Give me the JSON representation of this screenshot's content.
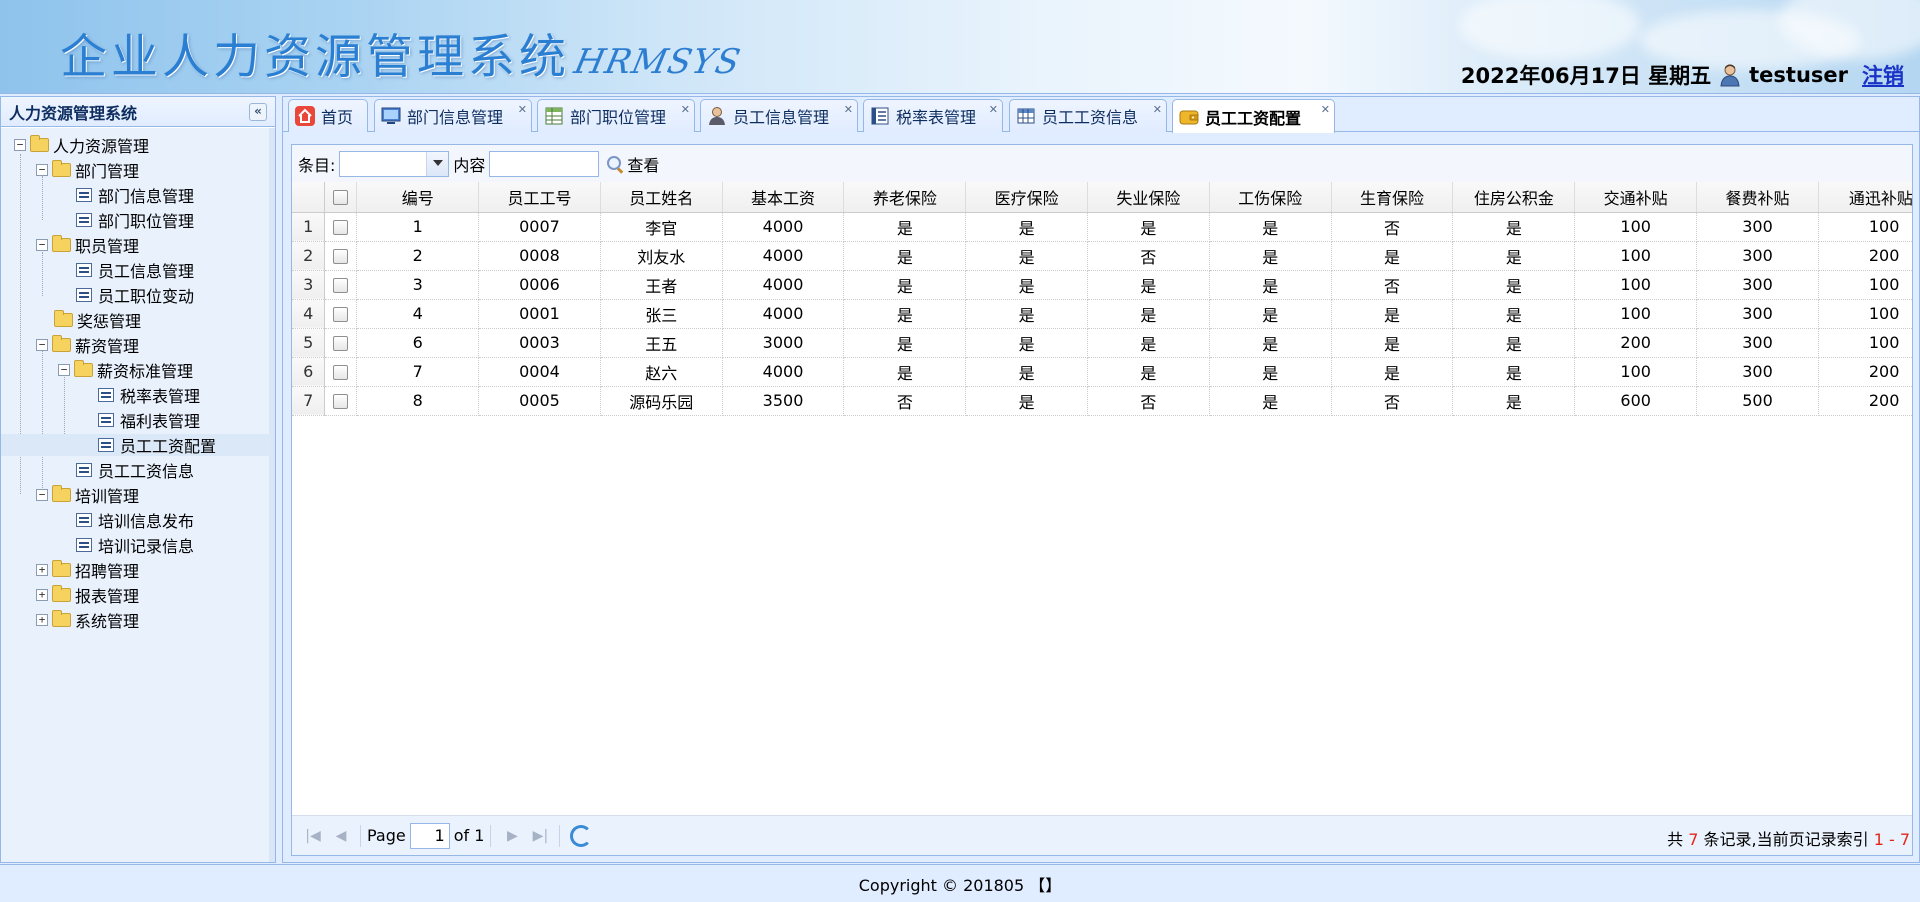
{
  "header": {
    "title": "企业人力资源管理系统",
    "subtitle": "HRMSYS",
    "date": "2022年06月17日 星期五",
    "username": "testuser",
    "logout_label": "注销"
  },
  "sidebar": {
    "title": "人力资源管理系统",
    "collapse_icon": "«",
    "tree": [
      {
        "label": "人力资源管理",
        "type": "folder",
        "toggle": "−"
      },
      {
        "label": "部门管理",
        "type": "folder",
        "toggle": "−"
      },
      {
        "label": "部门信息管理",
        "type": "file"
      },
      {
        "label": "部门职位管理",
        "type": "file"
      },
      {
        "label": "职员管理",
        "type": "folder",
        "toggle": "−"
      },
      {
        "label": "员工信息管理",
        "type": "file"
      },
      {
        "label": "员工职位变动",
        "type": "file"
      },
      {
        "label": "奖惩管理",
        "type": "folder"
      },
      {
        "label": "薪资管理",
        "type": "folder",
        "toggle": "−"
      },
      {
        "label": "薪资标准管理",
        "type": "folder",
        "toggle": "−"
      },
      {
        "label": "税率表管理",
        "type": "file"
      },
      {
        "label": "福利表管理",
        "type": "file"
      },
      {
        "label": "员工工资配置",
        "type": "file",
        "selected": true
      },
      {
        "label": "员工工资信息",
        "type": "file"
      },
      {
        "label": "培训管理",
        "type": "folder",
        "toggle": "−"
      },
      {
        "label": "培训信息发布",
        "type": "file"
      },
      {
        "label": "培训记录信息",
        "type": "file"
      },
      {
        "label": "招聘管理",
        "type": "folder",
        "toggle": "+"
      },
      {
        "label": "报表管理",
        "type": "folder",
        "toggle": "+"
      },
      {
        "label": "系统管理",
        "type": "folder",
        "toggle": "+"
      }
    ]
  },
  "tabs": [
    {
      "label": "首页",
      "icon": "home-icon",
      "closable": false
    },
    {
      "label": "部门信息管理",
      "icon": "monitor-icon",
      "closable": true
    },
    {
      "label": "部门职位管理",
      "icon": "table-green-icon",
      "closable": true
    },
    {
      "label": "员工信息管理",
      "icon": "user-icon",
      "closable": true
    },
    {
      "label": "税率表管理",
      "icon": "list-icon",
      "closable": true
    },
    {
      "label": "员工工资信息",
      "icon": "table-icon",
      "closable": true
    },
    {
      "label": "员工工资配置",
      "icon": "wallet-icon",
      "closable": true,
      "active": true
    }
  ],
  "toolbar": {
    "field_label": "条目:",
    "content_label": "内容",
    "field_value": "",
    "content_value": "",
    "search_label": "查看"
  },
  "grid": {
    "columns": [
      "编号",
      "员工工号",
      "员工姓名",
      "基本工资",
      "养老保险",
      "医疗保险",
      "失业保险",
      "工伤保险",
      "生育保险",
      "住房公积金",
      "交通补贴",
      "餐费补贴",
      "通迅补贴"
    ],
    "rows": [
      {
        "rn": "1",
        "cells": [
          "1",
          "0007",
          "李官",
          "4000",
          "是",
          "是",
          "是",
          "是",
          "否",
          "是",
          "100",
          "300",
          "100"
        ]
      },
      {
        "rn": "2",
        "cells": [
          "2",
          "0008",
          "刘友水",
          "4000",
          "是",
          "是",
          "否",
          "是",
          "是",
          "是",
          "100",
          "300",
          "200"
        ]
      },
      {
        "rn": "3",
        "cells": [
          "3",
          "0006",
          "王者",
          "4000",
          "是",
          "是",
          "是",
          "是",
          "否",
          "是",
          "100",
          "300",
          "100"
        ]
      },
      {
        "rn": "4",
        "cells": [
          "4",
          "0001",
          "张三",
          "4000",
          "是",
          "是",
          "是",
          "是",
          "是",
          "是",
          "100",
          "300",
          "100"
        ]
      },
      {
        "rn": "5",
        "cells": [
          "6",
          "0003",
          "王五",
          "3000",
          "是",
          "是",
          "是",
          "是",
          "是",
          "是",
          "200",
          "300",
          "100"
        ]
      },
      {
        "rn": "6",
        "cells": [
          "7",
          "0004",
          "赵六",
          "4000",
          "是",
          "是",
          "是",
          "是",
          "是",
          "是",
          "100",
          "300",
          "200"
        ]
      },
      {
        "rn": "7",
        "cells": [
          "8",
          "0005",
          "源码乐园",
          "3500",
          "否",
          "是",
          "否",
          "是",
          "否",
          "是",
          "600",
          "500",
          "200"
        ]
      }
    ]
  },
  "pager": {
    "page_label": "Page",
    "page_value": "1",
    "of_label": "of 1",
    "info_prefix": "共 ",
    "total": "7",
    "info_mid": " 条记录,当前页记录索引 ",
    "range": "1 - 7"
  },
  "footer": {
    "copyright": "Copyright © 201805 【】"
  },
  "colors": {
    "panel_border": "#95b8e7",
    "panel_bg": "#e0ecff",
    "title_blue": "#2a7fd2",
    "link_blue": "#1a33c7",
    "pager_red": "#e3261b"
  }
}
